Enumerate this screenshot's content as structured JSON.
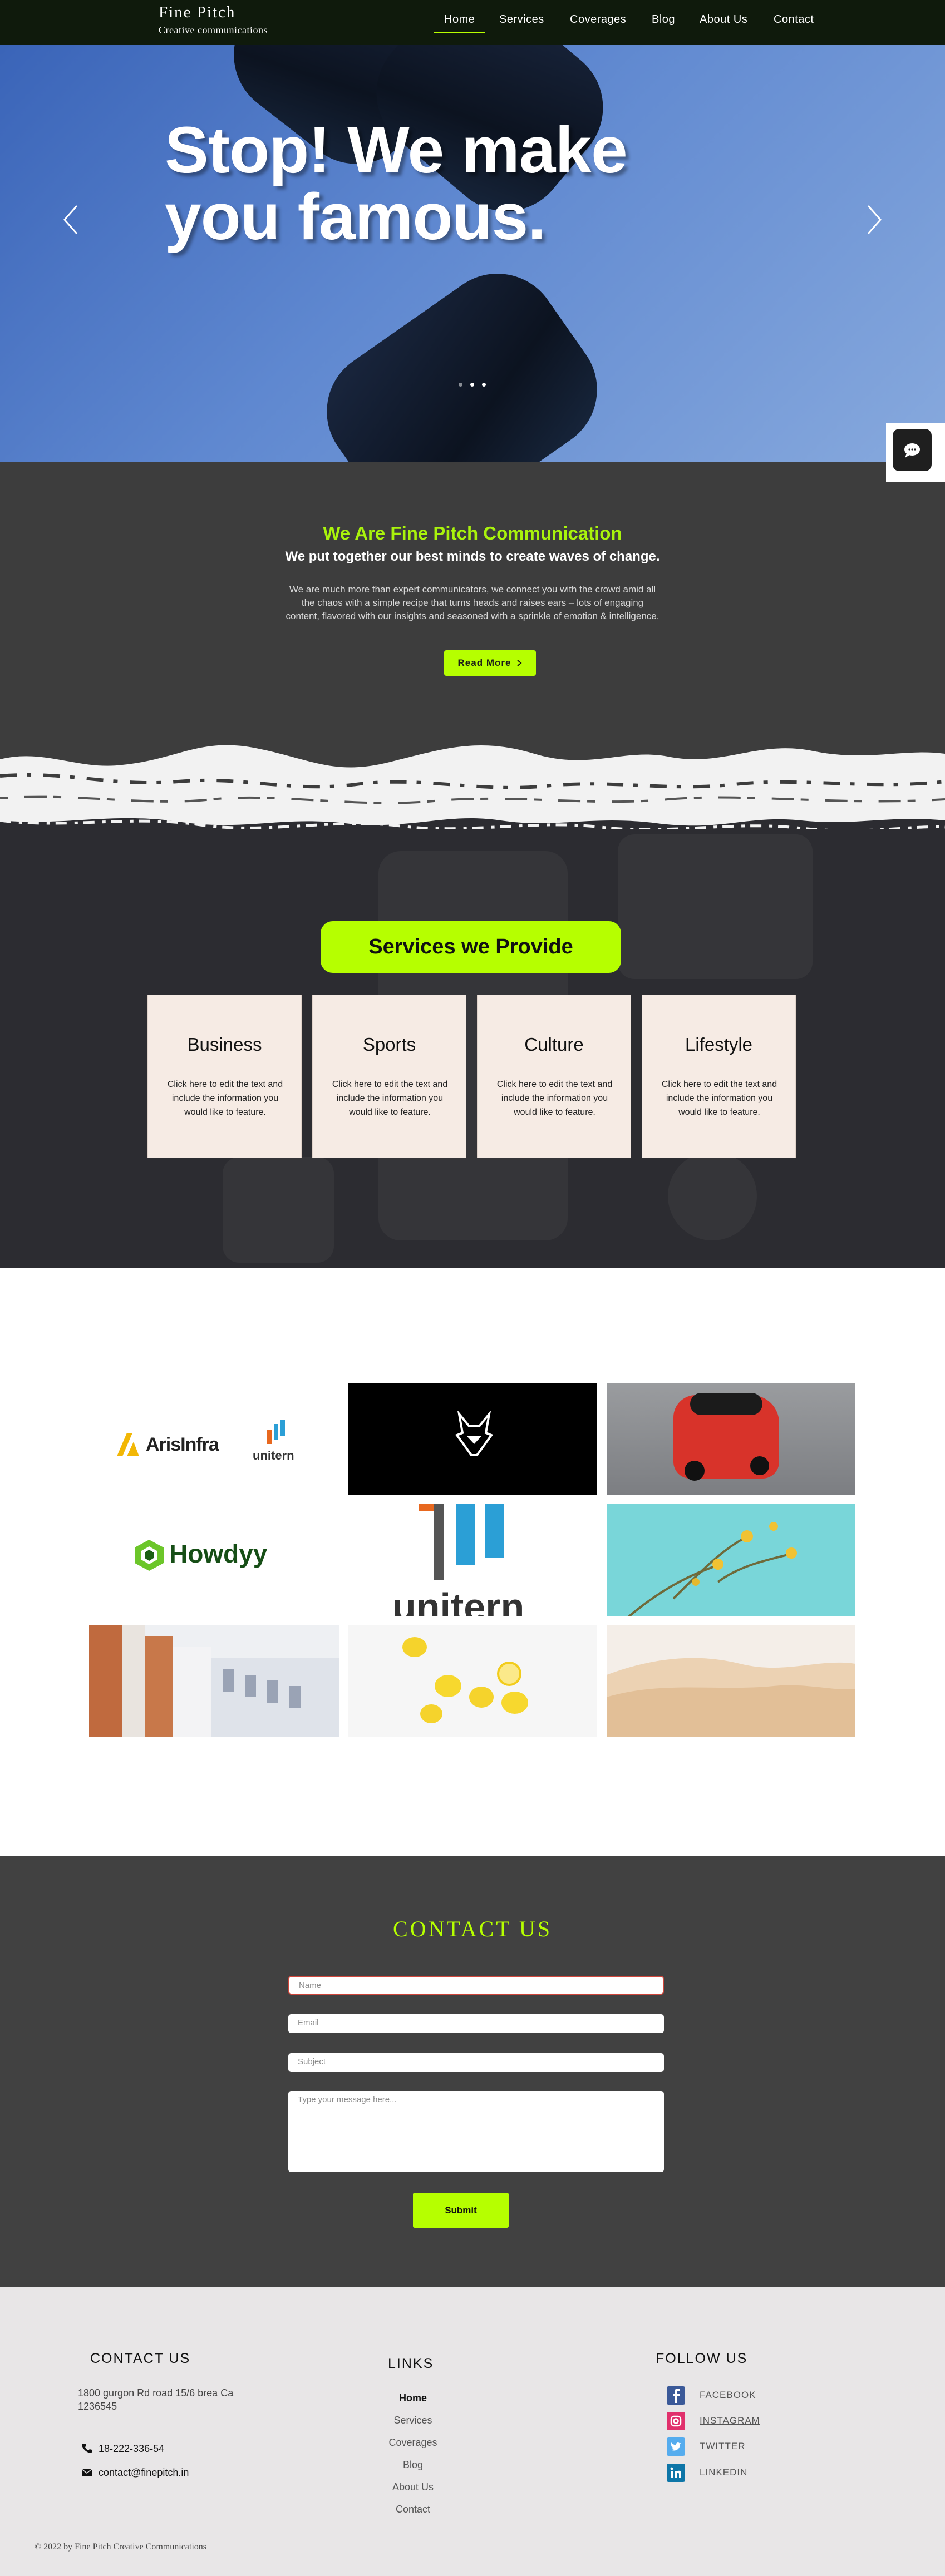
{
  "header": {
    "brand_name": "Fine Pitch",
    "brand_tagline": "Creative communications",
    "nav": [
      "Home",
      "Services",
      "Coverages",
      "Blog",
      "About Us",
      "Contact"
    ],
    "active_nav": "Home"
  },
  "hero": {
    "title_line1": "Stop! We make",
    "title_line2": "you famous.",
    "slide_count": 3,
    "active_slide": 2
  },
  "about": {
    "title": "We Are Fine Pitch Communication",
    "subtitle": "We put together our best minds to create waves of change.",
    "body": "We are much more than expert communicators, we connect you with the crowd amid all the chaos with a simple recipe that turns heads and raises ears – lots of engaging content, flavored with our insights and seasoned with a sprinkle of emotion & intelligence.",
    "button": "Read More"
  },
  "services": {
    "title": "Services we Provide",
    "cards": [
      {
        "title": "Business",
        "text": "Click here to edit the text and include the information you would like to feature."
      },
      {
        "title": "Sports",
        "text": "Click here to edit the text and include the information you would like to feature."
      },
      {
        "title": "Culture",
        "text": "Click here to edit the text and include the information you would like to feature."
      },
      {
        "title": "Lifestyle",
        "text": "Click here to edit the text and include the information you would like to feature."
      }
    ]
  },
  "gallery": {
    "logo_arisinfra": "ArisInfra",
    "logo_unitern_small": "unitern",
    "logo_howdyy": "Howdyy",
    "logo_unitern_large": "unitern"
  },
  "contact": {
    "title": "CONTACT US",
    "fields": {
      "name": "Name",
      "email": "Email",
      "subject": "Subject",
      "message": "Type your message here..."
    },
    "submit": "Submit"
  },
  "footer": {
    "contact_heading": "CONTACT US",
    "address": "1800 gurgon  Rd road 15/6 brea Ca 1236545",
    "phone": "18-222-336-54",
    "email": "contact@finepitch.in",
    "links_heading": "LINKS",
    "links": [
      "Home",
      "Services",
      "Coverages",
      "Blog",
      "About Us",
      "Contact"
    ],
    "follow_heading": "FOLLOW US",
    "social": [
      "FACEBOOK",
      "INSTAGRAM",
      "TWITTER",
      "LINKEDIN"
    ],
    "copyright": "© 2022 by Fine Pitch Creative Communications"
  },
  "colors": {
    "accent": "#b6ff00",
    "header_bg": "#0f1a0c",
    "section_dark": "#3d3d3d",
    "services_bg": "#2c2c31",
    "card_bg": "#f6ebe4",
    "footer_bg": "#e8e6e7",
    "facebook": "#3b5998",
    "instagram": "#e1306c",
    "twitter": "#55acee",
    "linkedin": "#0e76a8"
  },
  "icons": [
    "chevron-left-icon",
    "chevron-right-icon",
    "chat-icon",
    "chevron-right-small-icon",
    "phone-icon",
    "mail-icon",
    "facebook-icon",
    "instagram-icon",
    "twitter-icon",
    "linkedin-icon"
  ]
}
